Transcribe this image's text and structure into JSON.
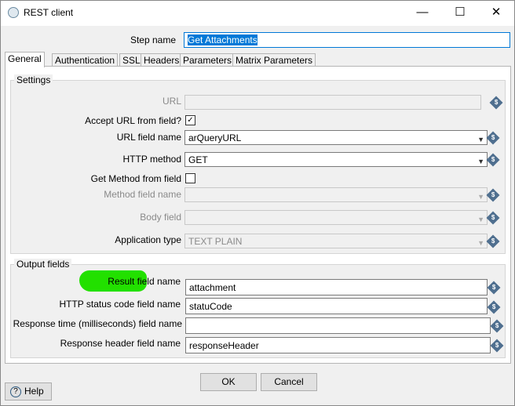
{
  "window": {
    "title": "REST client",
    "minimize": "—",
    "maximize": "☐",
    "close": "✕"
  },
  "step_name": {
    "label": "Step name",
    "value": "Get Attachments"
  },
  "tabs": [
    "General",
    "Authentication",
    "SSL",
    "Headers",
    "Parameters",
    "Matrix Parameters"
  ],
  "settings": {
    "title": "Settings",
    "url": {
      "label": "URL",
      "value": ""
    },
    "accept_url": {
      "label": "Accept URL from field?",
      "checked": true
    },
    "url_field": {
      "label": "URL field name",
      "value": "arQueryURL"
    },
    "http_method": {
      "label": "HTTP method",
      "value": "GET"
    },
    "get_method": {
      "label": "Get Method from field",
      "checked": false
    },
    "method_field": {
      "label": "Method field name",
      "value": ""
    },
    "body_field": {
      "label": "Body field",
      "value": ""
    },
    "app_type": {
      "label": "Application type",
      "value": "TEXT PLAIN"
    }
  },
  "output": {
    "title": "Output fields",
    "result": {
      "label": "Result field name",
      "value": "attachment"
    },
    "status": {
      "label": "HTTP status code field name",
      "value": "statuCode"
    },
    "resp_time": {
      "label": "Response time (milliseconds) field name",
      "value": ""
    },
    "resp_header": {
      "label": "Response header field name",
      "value": "responseHeader"
    }
  },
  "buttons": {
    "ok": "OK",
    "cancel": "Cancel",
    "help": "Help"
  },
  "icons": {
    "check": "✓",
    "dropdown": "▼",
    "variable": "$",
    "help": "?"
  },
  "colors": {
    "highlight": "#22e000",
    "selection": "#0078d7"
  }
}
